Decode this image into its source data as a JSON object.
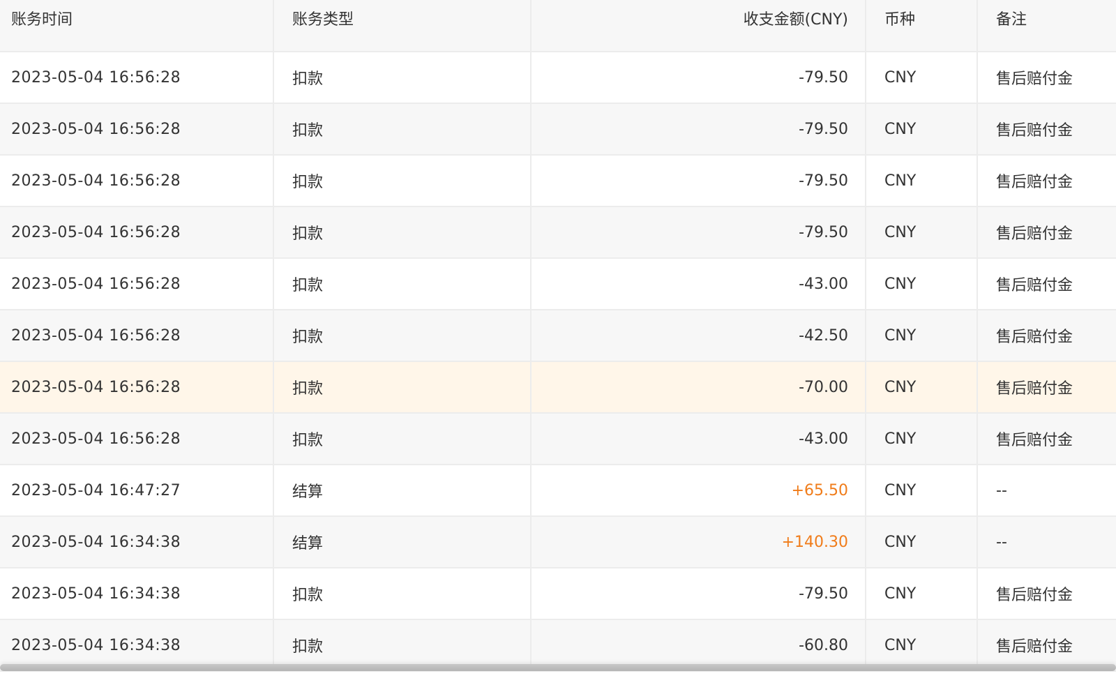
{
  "table": {
    "headers": {
      "time": "账务时间",
      "type": "账务类型",
      "amount": "收支金额(CNY)",
      "currency": "币种",
      "remark": "备注"
    },
    "rows": [
      {
        "time": "2023-05-04 16:56:28",
        "type": "扣款",
        "amount": "-79.50",
        "currency": "CNY",
        "remark": "售后赔付金"
      },
      {
        "time": "2023-05-04 16:56:28",
        "type": "扣款",
        "amount": "-79.50",
        "currency": "CNY",
        "remark": "售后赔付金"
      },
      {
        "time": "2023-05-04 16:56:28",
        "type": "扣款",
        "amount": "-79.50",
        "currency": "CNY",
        "remark": "售后赔付金"
      },
      {
        "time": "2023-05-04 16:56:28",
        "type": "扣款",
        "amount": "-79.50",
        "currency": "CNY",
        "remark": "售后赔付金"
      },
      {
        "time": "2023-05-04 16:56:28",
        "type": "扣款",
        "amount": "-43.00",
        "currency": "CNY",
        "remark": "售后赔付金"
      },
      {
        "time": "2023-05-04 16:56:28",
        "type": "扣款",
        "amount": "-42.50",
        "currency": "CNY",
        "remark": "售后赔付金"
      },
      {
        "time": "2023-05-04 16:56:28",
        "type": "扣款",
        "amount": "-70.00",
        "currency": "CNY",
        "remark": "售后赔付金",
        "highlighted": true
      },
      {
        "time": "2023-05-04 16:56:28",
        "type": "扣款",
        "amount": "-43.00",
        "currency": "CNY",
        "remark": "售后赔付金"
      },
      {
        "time": "2023-05-04 16:47:27",
        "type": "结算",
        "amount": "+65.50",
        "currency": "CNY",
        "remark": "--"
      },
      {
        "time": "2023-05-04 16:34:38",
        "type": "结算",
        "amount": "+140.30",
        "currency": "CNY",
        "remark": "--"
      },
      {
        "time": "2023-05-04 16:34:38",
        "type": "扣款",
        "amount": "-79.50",
        "currency": "CNY",
        "remark": "售后赔付金"
      },
      {
        "time": "2023-05-04 16:34:38",
        "type": "扣款",
        "amount": "-60.80",
        "currency": "CNY",
        "remark": "售后赔付金"
      }
    ]
  },
  "colors": {
    "positive_amount": "#f07c1a",
    "highlight_row": "#fff6e9",
    "header_bg": "#f7f7f7"
  }
}
